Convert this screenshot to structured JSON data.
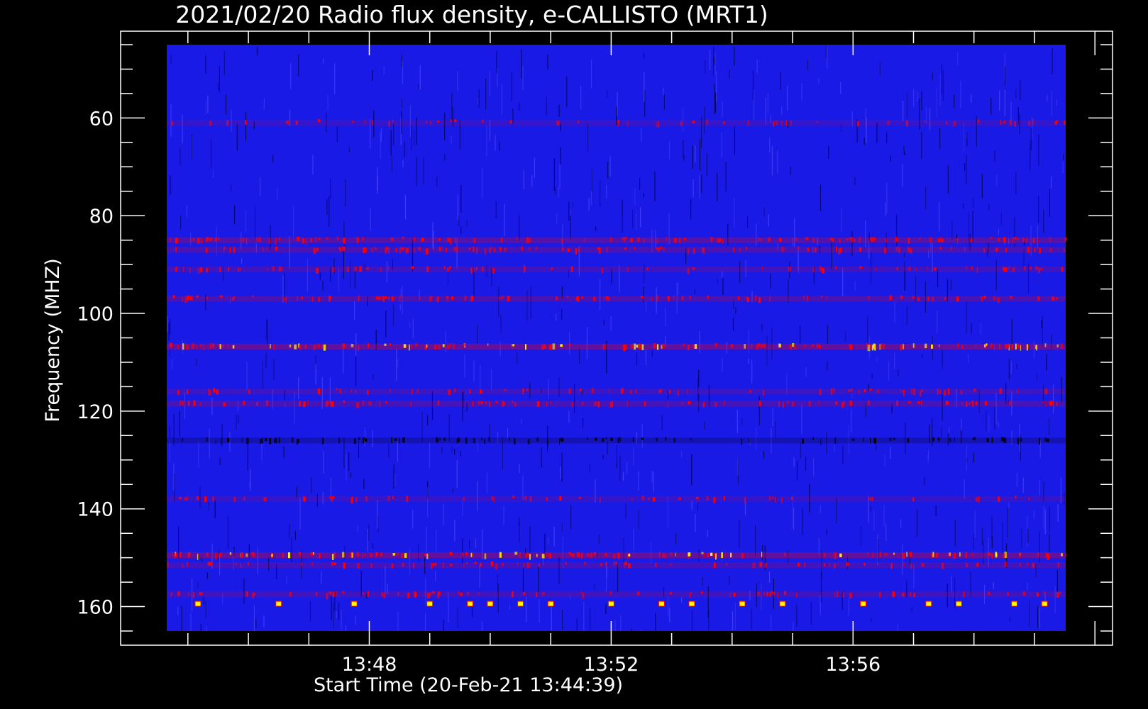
{
  "chart_data": {
    "type": "heatmap",
    "title": "2021/02/20  Radio flux density, e-CALLISTO (MRT1)",
    "xlabel": "Start Time (20-Feb-21 13:44:39)",
    "ylabel": "Frequency (MHZ)",
    "x_start": "13:44:39",
    "x_end": "13:59:31",
    "ylim": [
      45,
      165
    ],
    "y_inverted": true,
    "x_ticks": [
      "13:48",
      "13:52",
      "13:56"
    ],
    "y_ticks": [
      60,
      80,
      100,
      120,
      140,
      160
    ],
    "colormap": [
      "#000000",
      "#0000ff",
      "#ff0000",
      "#ffff00"
    ],
    "background_color": "#1a1ae6",
    "features": [
      {
        "kind": "band",
        "freq": 61,
        "intensity": 0.35
      },
      {
        "kind": "band",
        "freq": 85,
        "intensity": 0.75
      },
      {
        "kind": "band",
        "freq": 87,
        "intensity": 0.6
      },
      {
        "kind": "band",
        "freq": 91,
        "intensity": 0.45
      },
      {
        "kind": "band",
        "freq": 97,
        "intensity": 0.6
      },
      {
        "kind": "band",
        "freq": 106.8,
        "intensity": 0.9
      },
      {
        "kind": "band",
        "freq": 116,
        "intensity": 0.4
      },
      {
        "kind": "band",
        "freq": 118.5,
        "intensity": 0.55
      },
      {
        "kind": "dark-band",
        "freq": 126,
        "intensity": 0.6
      },
      {
        "kind": "band",
        "freq": 138,
        "intensity": 0.35
      },
      {
        "kind": "band",
        "freq": 149.5,
        "intensity": 0.9
      },
      {
        "kind": "band",
        "freq": 151.5,
        "intensity": 0.5
      },
      {
        "kind": "band",
        "freq": 157.5,
        "intensity": 0.5
      }
    ],
    "bursts": [
      {
        "time": "13:45:10",
        "freq": 159.5
      },
      {
        "time": "13:46:30",
        "freq": 159.5
      },
      {
        "time": "13:47:45",
        "freq": 159.5
      },
      {
        "time": "13:49:00",
        "freq": 159.5
      },
      {
        "time": "13:49:40",
        "freq": 159.5
      },
      {
        "time": "13:50:00",
        "freq": 159.5
      },
      {
        "time": "13:50:30",
        "freq": 159.5
      },
      {
        "time": "13:51:00",
        "freq": 159.5
      },
      {
        "time": "13:52:00",
        "freq": 159.5
      },
      {
        "time": "13:52:50",
        "freq": 159.5
      },
      {
        "time": "13:53:20",
        "freq": 159.5
      },
      {
        "time": "13:54:10",
        "freq": 159.5
      },
      {
        "time": "13:54:50",
        "freq": 159.5
      },
      {
        "time": "13:56:10",
        "freq": 159.5
      },
      {
        "time": "13:57:15",
        "freq": 159.5
      },
      {
        "time": "13:57:45",
        "freq": 159.5
      },
      {
        "time": "13:58:40",
        "freq": 159.5
      },
      {
        "time": "13:59:10",
        "freq": 159.5
      }
    ],
    "grid": false
  }
}
